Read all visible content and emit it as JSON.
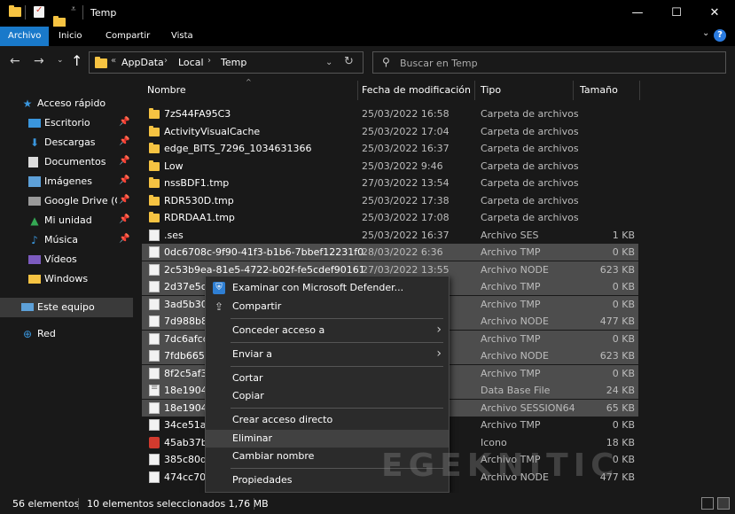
{
  "window": {
    "title": "Temp",
    "minimize": "—",
    "maximize": "☐",
    "close": "✕"
  },
  "ribbon": {
    "tabs": [
      "Archivo",
      "Inicio",
      "Compartir",
      "Vista"
    ],
    "expand": "⌄",
    "help": "?"
  },
  "address": {
    "crumbs": [
      "AppData",
      "Local",
      "Temp"
    ],
    "prefix": "«"
  },
  "search": {
    "placeholder": "Buscar en Temp"
  },
  "nav": {
    "items": [
      {
        "label": "Acceso rápido",
        "icon": "star-icon"
      },
      {
        "label": "Escritorio",
        "icon": "desktop-icon"
      },
      {
        "label": "Descargas",
        "icon": "download-icon"
      },
      {
        "label": "Documentos",
        "icon": "documents-icon"
      },
      {
        "label": "Imágenes",
        "icon": "pictures-icon"
      },
      {
        "label": "Google Drive (G:",
        "icon": "google-drive-icon"
      },
      {
        "label": "Mi unidad",
        "icon": "drive-icon"
      },
      {
        "label": "Música",
        "icon": "music-icon"
      },
      {
        "label": "Vídeos",
        "icon": "videos-icon"
      },
      {
        "label": "Windows",
        "icon": "folder-icon"
      },
      {
        "label": "Este equipo",
        "icon": "computer-icon"
      },
      {
        "label": "Red",
        "icon": "network-icon"
      }
    ]
  },
  "columns": {
    "name": "Nombre",
    "modified": "Fecha de modificación",
    "type": "Tipo",
    "size": "Tamaño"
  },
  "files": [
    {
      "name": "7zS44FA95C3",
      "date": "25/03/2022 16:58",
      "type": "Carpeta de archivos",
      "size": "",
      "icon": "folder"
    },
    {
      "name": "ActivityVisualCache",
      "date": "25/03/2022 17:04",
      "type": "Carpeta de archivos",
      "size": "",
      "icon": "folder"
    },
    {
      "name": "edge_BITS_7296_1034631366",
      "date": "25/03/2022 16:37",
      "type": "Carpeta de archivos",
      "size": "",
      "icon": "folder"
    },
    {
      "name": "Low",
      "date": "25/03/2022 9:46",
      "type": "Carpeta de archivos",
      "size": "",
      "icon": "folder"
    },
    {
      "name": "nssBDF1.tmp",
      "date": "27/03/2022 13:54",
      "type": "Carpeta de archivos",
      "size": "",
      "icon": "folder"
    },
    {
      "name": "RDR530D.tmp",
      "date": "25/03/2022 17:38",
      "type": "Carpeta de archivos",
      "size": "",
      "icon": "folder"
    },
    {
      "name": "RDRDAA1.tmp",
      "date": "25/03/2022 17:08",
      "type": "Carpeta de archivos",
      "size": "",
      "icon": "folder"
    },
    {
      "name": ".ses",
      "date": "25/03/2022 16:37",
      "type": "Archivo SES",
      "size": "1 KB",
      "icon": "doc"
    },
    {
      "name": "0dc6708c-9f90-41f3-b1b6-7bbef12231f0.t...",
      "date": "28/03/2022 6:36",
      "type": "Archivo TMP",
      "size": "0 KB",
      "icon": "doc",
      "selected": true
    },
    {
      "name": "2c53b9ea-81e5-4722-b02f-fe5cdef90161.t...",
      "date": "27/03/2022 13:55",
      "type": "Archivo NODE",
      "size": "623 KB",
      "icon": "doc",
      "selected": true
    },
    {
      "name": "2d37e5c2",
      "date": "",
      "type": "Archivo TMP",
      "size": "0 KB",
      "icon": "doc",
      "selected": true
    },
    {
      "name": "3ad5b301",
      "date": "",
      "type": "Archivo TMP",
      "size": "0 KB",
      "icon": "doc",
      "selected": true
    },
    {
      "name": "7d988b8e",
      "date": "",
      "type": "Archivo NODE",
      "size": "477 KB",
      "icon": "doc",
      "selected": true
    },
    {
      "name": "7dc6afcd",
      "date": "",
      "type": "Archivo TMP",
      "size": "0 KB",
      "icon": "doc",
      "selected": true
    },
    {
      "name": "7fdb6652",
      "date": "",
      "type": "Archivo NODE",
      "size": "623 KB",
      "icon": "doc",
      "selected": true
    },
    {
      "name": "8f2c5af3",
      "date": "",
      "type": "Archivo TMP",
      "size": "0 KB",
      "icon": "doc",
      "selected": true
    },
    {
      "name": "18e19041",
      "date": "",
      "type": "Data Base File",
      "size": "24 KB",
      "icon": "db",
      "selected": true
    },
    {
      "name": "18e19041",
      "date": "",
      "type": "Archivo SESSION64",
      "size": "65 KB",
      "icon": "doc",
      "selected": true
    },
    {
      "name": "34ce51a9",
      "date": "",
      "type": "Archivo TMP",
      "size": "0 KB",
      "icon": "doc"
    },
    {
      "name": "45ab37ba",
      "date": "",
      "type": "Icono",
      "size": "18 KB",
      "icon": "ico"
    },
    {
      "name": "385c80df",
      "date": "",
      "type": "Archivo TMP",
      "size": "0 KB",
      "icon": "doc"
    },
    {
      "name": "474cc706",
      "date": "",
      "type": "Archivo NODE",
      "size": "477 KB",
      "icon": "doc"
    }
  ],
  "context_menu": {
    "items": [
      {
        "label": "Examinar con Microsoft Defender...",
        "icon": "defender-shield-icon"
      },
      {
        "label": "Compartir",
        "icon": "share-icon"
      },
      {
        "label": "Conceder acceso a",
        "submenu": true
      },
      {
        "label": "Enviar a",
        "submenu": true
      },
      {
        "label": "Cortar"
      },
      {
        "label": "Copiar"
      },
      {
        "label": "Crear acceso directo"
      },
      {
        "label": "Eliminar",
        "hover": true
      },
      {
        "label": "Cambiar nombre"
      },
      {
        "label": "Propiedades"
      }
    ]
  },
  "status": {
    "count": "56 elementos",
    "selected": "10 elementos seleccionados  1,76 MB"
  },
  "watermark": "EGEKNITIC",
  "colors": {
    "accent": "#1979ca",
    "folder": "#f6c342",
    "selection": "#4d4d4d",
    "background": "#191919"
  }
}
